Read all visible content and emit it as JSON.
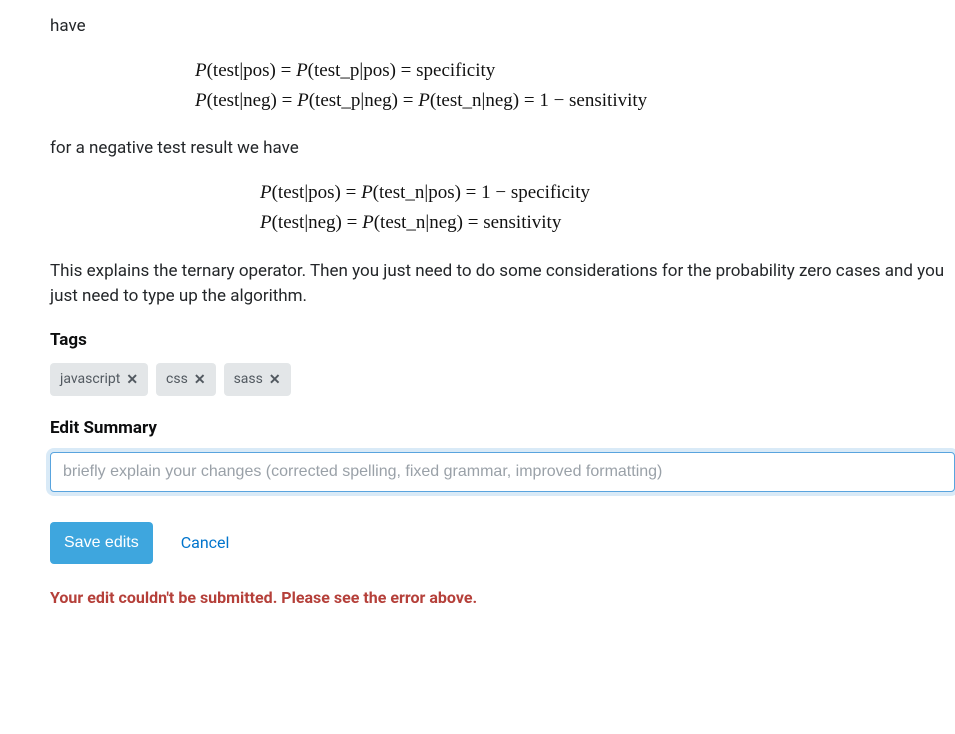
{
  "content": {
    "intro_fragment": "have",
    "eq1_line1": "P(test|pos) = P(test_p|pos) = specificity",
    "eq1_line2": "P(test|neg) = P(test_p|neg) = P(test_n|neg) = 1 − sensitivity",
    "mid_para": "for a negative test result we have",
    "eq2_line1": "P(test|pos) = P(test_n|pos) = 1 − specificity",
    "eq2_line2": "P(test|neg) = P(test_n|neg) = sensitivity",
    "closing_para": "This explains the ternary operator. Then you just need to do some considerations for the probability zero cases and you just need to type up the algorithm."
  },
  "tags": {
    "label": "Tags",
    "items": [
      {
        "name": "javascript"
      },
      {
        "name": "css"
      },
      {
        "name": "sass"
      }
    ]
  },
  "edit_summary": {
    "label": "Edit Summary",
    "placeholder": "briefly explain your changes (corrected spelling, fixed grammar, improved formatting)",
    "value": ""
  },
  "actions": {
    "save_label": "Save edits",
    "cancel_label": "Cancel"
  },
  "error": {
    "message": "Your edit couldn't be submitted. Please see the error above."
  }
}
